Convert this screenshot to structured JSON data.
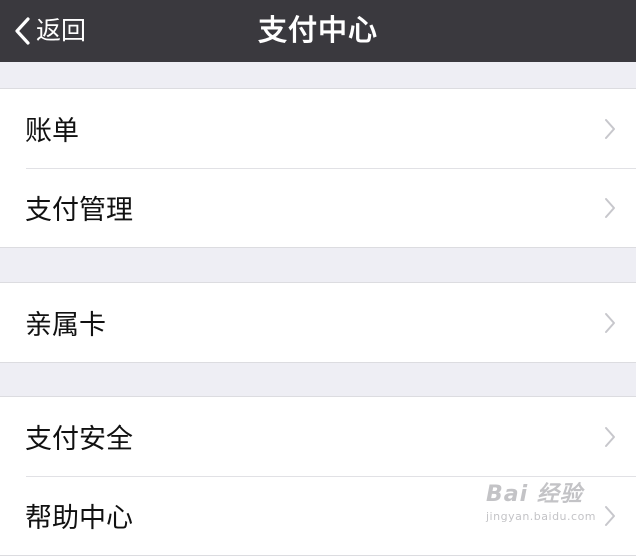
{
  "navbar": {
    "back_label": "返回",
    "title": "支付中心"
  },
  "groups": [
    {
      "items": [
        {
          "label": "账单"
        },
        {
          "label": "支付管理"
        }
      ]
    },
    {
      "items": [
        {
          "label": "亲属卡"
        }
      ]
    },
    {
      "items": [
        {
          "label": "支付安全"
        },
        {
          "label": "帮助中心"
        }
      ]
    }
  ],
  "watermark": {
    "brand": "Bai 经验",
    "url": "jingyan.baidu.com"
  },
  "colors": {
    "navbar_bg": "#3a393e",
    "page_bg": "#eeeef4",
    "row_bg": "#ffffff",
    "chevron": "#c7c7cc"
  }
}
